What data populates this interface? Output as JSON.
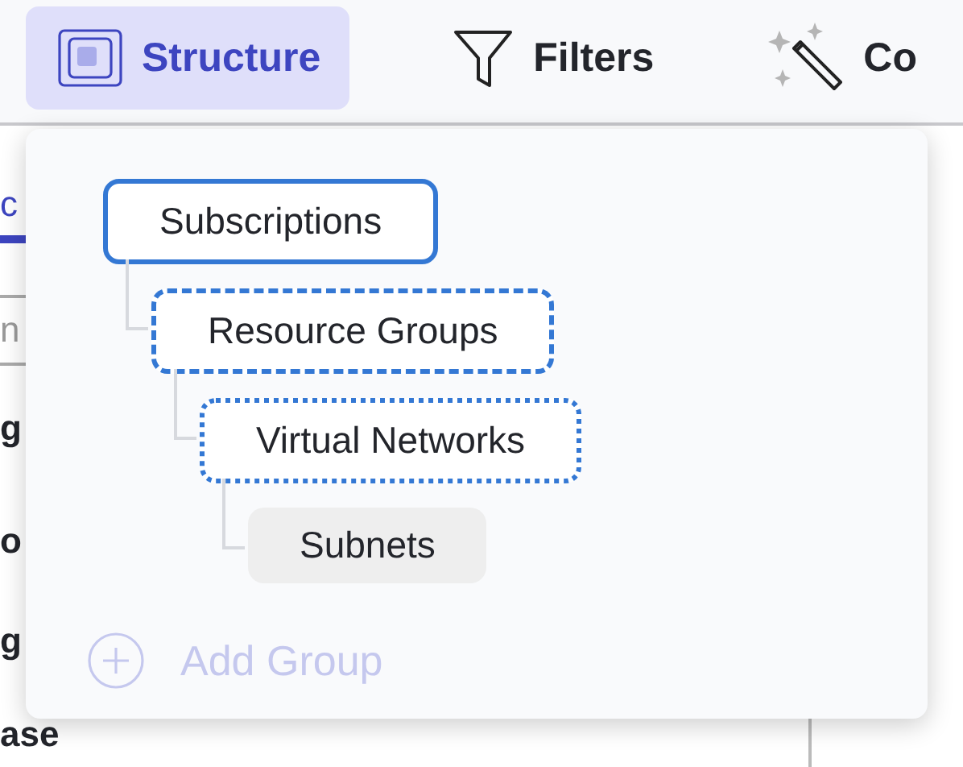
{
  "toolbar": [
    {
      "kind": "structure",
      "label": "Structure",
      "selected": true
    },
    {
      "kind": "filter",
      "label": "Filters",
      "selected": false
    },
    {
      "kind": "wand",
      "label": "Co",
      "selected": false
    }
  ],
  "background": {
    "tab": "c",
    "field": "n",
    "rows": [
      "g",
      "o",
      "g",
      "ase"
    ]
  },
  "structure_menu": {
    "tree": [
      {
        "label": "Subscriptions",
        "kind": "solid",
        "children": [
          {
            "label": "Resource Groups",
            "kind": "dashed",
            "children": [
              {
                "label": "Virtual Networks",
                "kind": "dotted",
                "children": [
                  {
                    "label": "Subnets",
                    "kind": "plain"
                  }
                ]
              }
            ]
          }
        ]
      }
    ],
    "add_group": {
      "label": "Add Group",
      "disabled": true
    }
  }
}
